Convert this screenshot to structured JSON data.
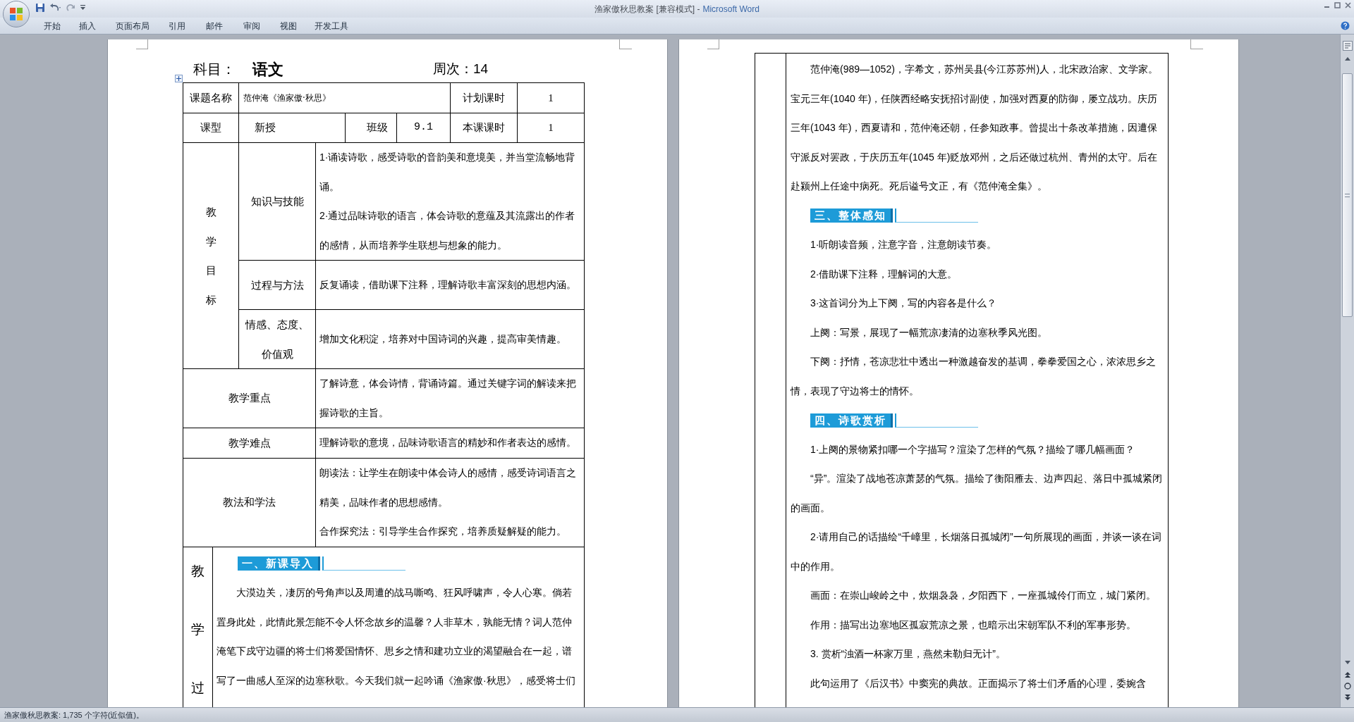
{
  "window": {
    "document_title": "渔家傲秋思教案 [兼容模式] -",
    "app_name": "Microsoft Word"
  },
  "ribbon_tabs": [
    "开始",
    "插入",
    "页面布局",
    "引用",
    "邮件",
    "审阅",
    "视图",
    "开发工具"
  ],
  "left_page": {
    "subject_label": "科目：",
    "subject": "语文",
    "week": "周次：14",
    "header": {
      "topic_label": "课题名称",
      "topic": "范仲淹《渔家傲·秋思》",
      "planned_hours_label": "计划课时",
      "planned_hours": "1",
      "type_label": "课型",
      "type": "新授",
      "class_label": "班级",
      "class": "9.1",
      "hours_label": "本课课时",
      "hours": "1"
    },
    "objectives": {
      "label": "教学目标",
      "items": [
        {
          "heading": "知识与技能",
          "paragraphs": [
            "1·诵读诗歌，感受诗歌的音韵美和意境美，并当堂流畅地背诵。",
            "2·通过品味诗歌的语言，体会诗歌的意蕴及其流露出的作者的感情，从而培养学生联想与想象的能力。"
          ]
        },
        {
          "heading": "过程与方法",
          "paragraphs": [
            "反复诵读，借助课下注释，理解诗歌丰富深刻的思想内涵。"
          ]
        },
        {
          "heading": "情感、态度、价值观",
          "paragraphs": [
            "增加文化积淀，培养对中国诗词的兴趣，提高审美情趣。"
          ]
        }
      ]
    },
    "rows": [
      {
        "label": "教学重点",
        "paragraphs": [
          "了解诗意，体会诗情，背诵诗篇。通过关键字词的解读来把握诗歌的主旨。"
        ]
      },
      {
        "label": "教学难点",
        "paragraphs": [
          "理解诗歌的意境，品味诗歌语言的精妙和作者表达的感情。"
        ]
      },
      {
        "label": "教法和学法",
        "paragraphs": [
          "朗读法：让学生在朗读中体会诗人的感情，感受诗词语言之精美，品味作者的思想感情。",
          "合作探究法：引导学生合作探究，培养质疑解疑的能力。"
        ]
      }
    ],
    "process": {
      "label": "教学过",
      "heading": "一、新课导入",
      "paragraph": "大漠边关，凄厉的号角声以及周遭的战马嘶鸣、狂风呼啸声，令人心寒。倘若置身此处，此情此景怎能不令人怀念故乡的温馨？人非草木，孰能无情？词人范仲淹笔下戍守边疆的将士们将爱国情怀、思乡之情和建功立业的渴望融合在一起，谱写了一曲感人至深的边塞秋歌。今天我们就一起吟诵《渔家傲·秋思》，感受将士们"
    }
  },
  "right_page": {
    "blocks": [
      {
        "kind": "paragraph",
        "text": "范仲淹(989—1052)，字希文，苏州吴县(今江苏苏州)人，北宋政治家、文学家。宝元三年(1040 年)，任陕西经略安抚招讨副使，加强对西夏的防御，屡立战功。庆历三年(1043 年)，西夏请和，范仲淹还朝，任参知政事。曾提出十条改革措施，因遭保守派反对罢政，于庆历五年(1045 年)贬放邓州，之后还做过杭州、青州的太守。后在赴颍州上任途中病死。死后谥号文正，有《范仲淹全集》。"
      },
      {
        "kind": "heading",
        "text": "三、整体感知"
      },
      {
        "kind": "paragraph",
        "text": "1·听朗读音频，注意字音，注意朗读节奏。"
      },
      {
        "kind": "paragraph",
        "text": "2·借助课下注释，理解词的大意。"
      },
      {
        "kind": "paragraph",
        "text": "3·这首词分为上下阕，写的内容各是什么？"
      },
      {
        "kind": "paragraph",
        "text": "上阕：写景，展现了一幅荒凉凄清的边塞秋季风光图。"
      },
      {
        "kind": "paragraph",
        "text": "下阕：抒情，苍凉悲壮中透出一种激越奋发的基调，拳拳爱国之心，浓浓思乡之情，表现了守边将士的情怀。"
      },
      {
        "kind": "heading",
        "text": "四、诗歌赏析"
      },
      {
        "kind": "paragraph",
        "text": "1·上阕的景物紧扣哪一个字描写？渲染了怎样的气氛？描绘了哪几幅画面？"
      },
      {
        "kind": "paragraph",
        "text": "“异”。渲染了战地苍凉萧瑟的气氛。描绘了衡阳雁去、边声四起、落日中孤城紧闭的画面。"
      },
      {
        "kind": "paragraph",
        "text": "2·请用自己的话描绘“千嶂里，长烟落日孤城闭”一句所展现的画面，并谈一谈在词中的作用。"
      },
      {
        "kind": "paragraph",
        "text": "画面：在崇山峻岭之中，炊烟袅袅，夕阳西下，一座孤城伶仃而立，城门紧闭。"
      },
      {
        "kind": "paragraph",
        "text": "作用：描写出边塞地区孤寂荒凉之景，也暗示出宋朝军队不利的军事形势。"
      },
      {
        "kind": "paragraph",
        "text": "3. 赏析“浊酒一杯家万里，燕然未勒归无计”。"
      },
      {
        "kind": "paragraph",
        "text": "此句运用了《后汉书》中窦宪的典故。正面揭示了将士们矛盾的心理，委婉含"
      }
    ]
  },
  "status_bar": "渔家傲秋思教案: 1,735 个字符(近似值)。"
}
